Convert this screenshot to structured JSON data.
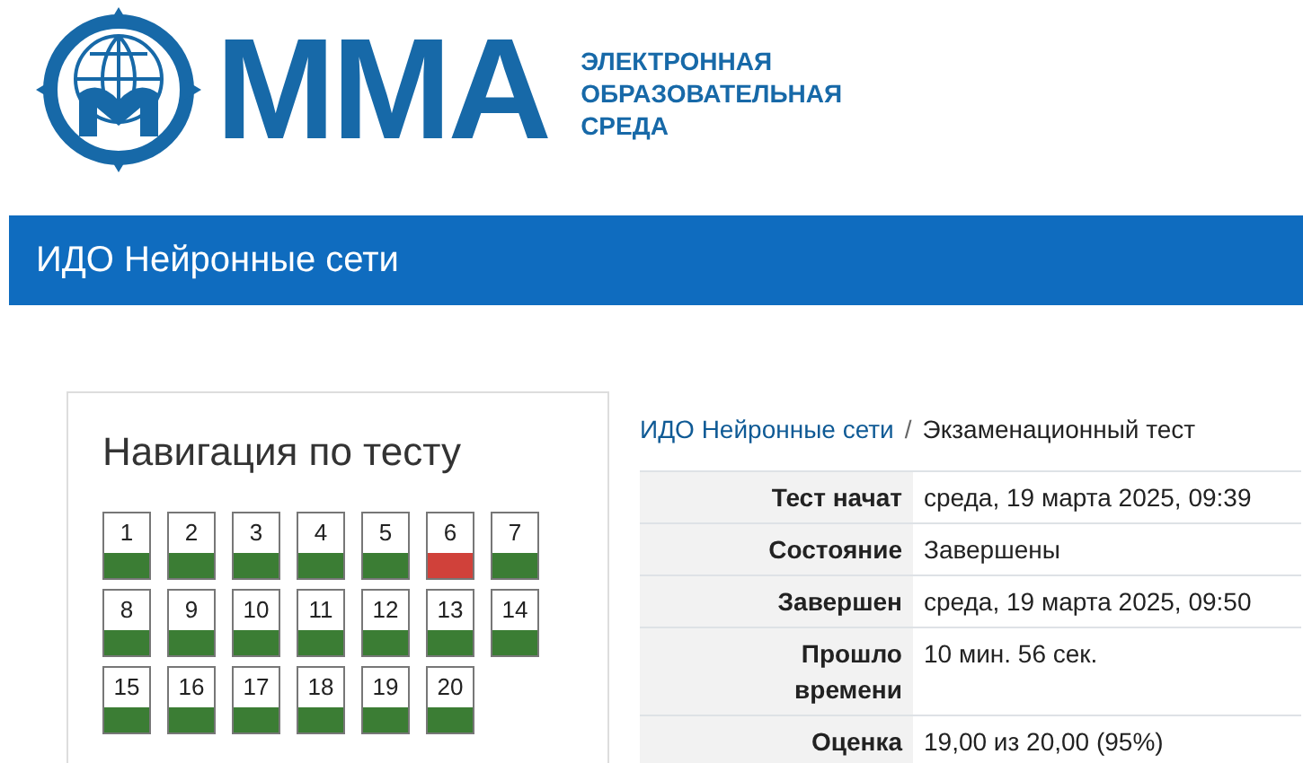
{
  "logo": {
    "wordmark": "ММА",
    "tagline": [
      "ЭЛЕКТРОННАЯ",
      "ОБРАЗОВАТЕЛЬНАЯ",
      "СРЕДА"
    ]
  },
  "course_bar": {
    "title": "ИДО Нейронные сети"
  },
  "navigation": {
    "title": "Навигация по тесту",
    "questions": [
      {
        "label": "1",
        "correct": true
      },
      {
        "label": "2",
        "correct": true
      },
      {
        "label": "3",
        "correct": true
      },
      {
        "label": "4",
        "correct": true
      },
      {
        "label": "5",
        "correct": true
      },
      {
        "label": "6",
        "correct": false
      },
      {
        "label": "7",
        "correct": true
      },
      {
        "label": "8",
        "correct": true
      },
      {
        "label": "9",
        "correct": true
      },
      {
        "label": "10",
        "correct": true
      },
      {
        "label": "11",
        "correct": true
      },
      {
        "label": "12",
        "correct": true
      },
      {
        "label": "13",
        "correct": true
      },
      {
        "label": "14",
        "correct": true
      },
      {
        "label": "15",
        "correct": true
      },
      {
        "label": "16",
        "correct": true
      },
      {
        "label": "17",
        "correct": true
      },
      {
        "label": "18",
        "correct": true
      },
      {
        "label": "19",
        "correct": true
      },
      {
        "label": "20",
        "correct": true
      }
    ]
  },
  "breadcrumb": {
    "link": "ИДО Нейронные сети",
    "separator": "/",
    "current": "Экзаменационный тест"
  },
  "summary": [
    {
      "label": "Тест начат",
      "value": "среда, 19 марта 2025, 09:39"
    },
    {
      "label": "Состояние",
      "value": "Завершены"
    },
    {
      "label": "Завершен",
      "value": "среда, 19 марта 2025, 09:50"
    },
    {
      "label": "Прошло времени",
      "value": "10 мин. 56 сек."
    },
    {
      "label": "Оценка",
      "value": "19,00 из 20,00 (95%)"
    }
  ]
}
